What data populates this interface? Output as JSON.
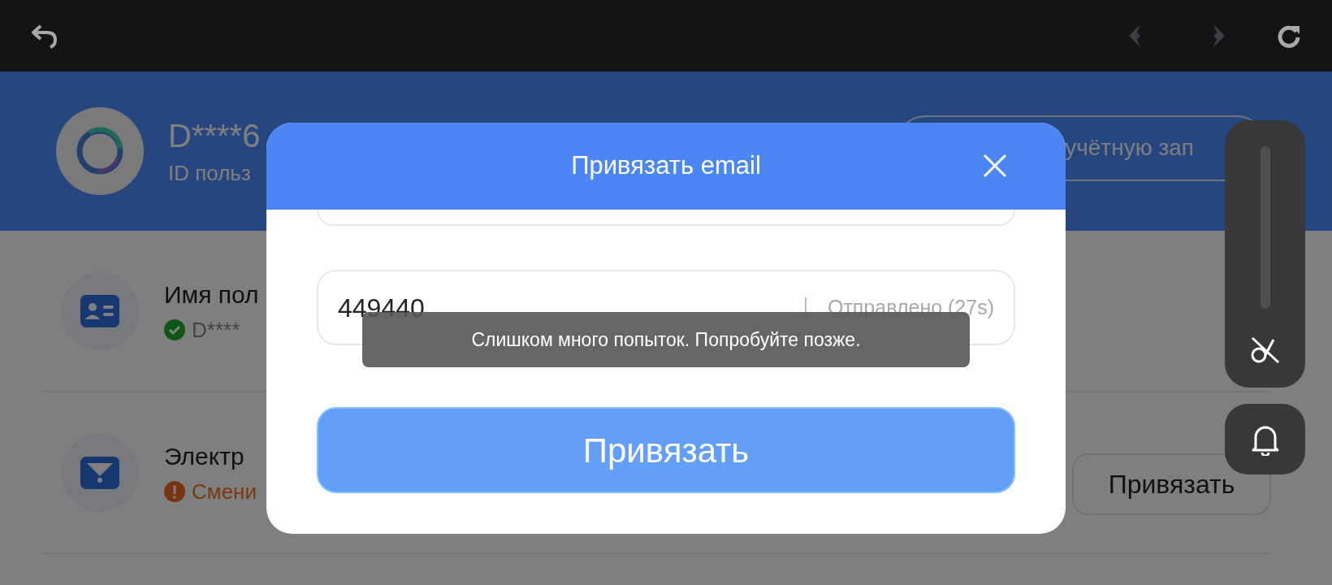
{
  "profile": {
    "name": "D****6",
    "user_id": "ID польз",
    "account_button": "учётную зап"
  },
  "rows": [
    {
      "kind": "card",
      "title": "Имя пол",
      "status": {
        "kind": "ok",
        "text": "D****"
      }
    },
    {
      "kind": "mail",
      "title": "Электр",
      "status": {
        "kind": "warning",
        "text": "Смени"
      },
      "action": "Привязать"
    }
  ],
  "dialog": {
    "title": "Привязать email",
    "code": "449440",
    "send_status": "Отправлено (27s)",
    "submit": "Привязать"
  },
  "toast": "Слишком много попыток. Попробуйте позже.",
  "volume_panel": {
    "level": 0
  }
}
